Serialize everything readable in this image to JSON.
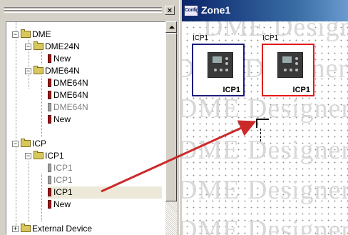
{
  "tree": {
    "rows": [
      {
        "type": "folder",
        "label": "DME",
        "expander": "−"
      },
      {
        "type": "folder",
        "label": "DME24N",
        "expander": "−"
      },
      {
        "type": "device",
        "label": "New",
        "state": "normal"
      },
      {
        "type": "folder",
        "label": "DME64N",
        "expander": "−"
      },
      {
        "type": "device",
        "label": "DME64N",
        "state": "normal"
      },
      {
        "type": "device",
        "label": "DME64N",
        "state": "normal"
      },
      {
        "type": "device",
        "label": "DME64N",
        "state": "disabled"
      },
      {
        "type": "device",
        "label": "New",
        "state": "normal"
      },
      {
        "type": "folder",
        "label": "ICP",
        "expander": "−"
      },
      {
        "type": "folder",
        "label": "ICP1",
        "expander": "−"
      },
      {
        "type": "device",
        "label": "ICP1",
        "state": "disabled"
      },
      {
        "type": "device",
        "label": "ICP1",
        "state": "disabled"
      },
      {
        "type": "device",
        "label": "ICP1",
        "state": "selected"
      },
      {
        "type": "device",
        "label": "New",
        "state": "normal"
      },
      {
        "type": "folder",
        "label": "External Device",
        "expander": "+"
      }
    ]
  },
  "zone": {
    "icon_text": "Config",
    "title": "Zone1",
    "components": [
      {
        "top_label": "ICP1",
        "name": "ICP1",
        "border": "#1c1c7a"
      },
      {
        "top_label": "ICP1",
        "name": "ICP1",
        "border": "#e01818"
      }
    ],
    "watermark": "DME Designer"
  },
  "colors": {
    "arrow": "#cc2a2a",
    "selected_border": "#e01818"
  }
}
